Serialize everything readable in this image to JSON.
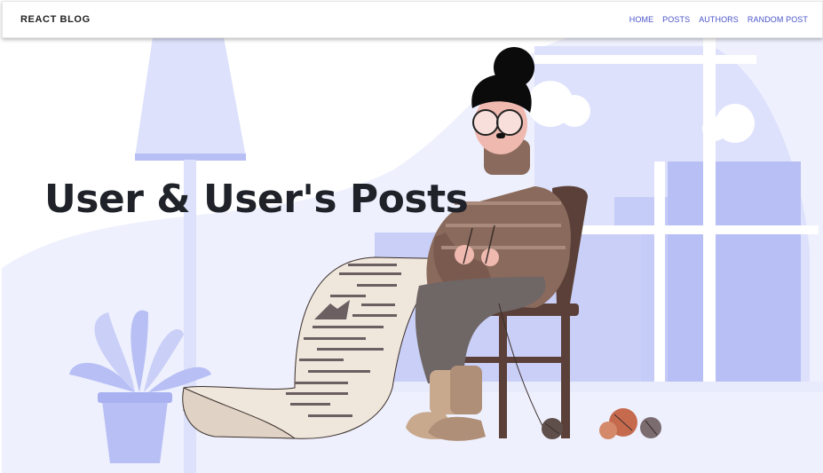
{
  "navbar": {
    "brand": "REACT BLOG",
    "links": [
      {
        "label": "HOME"
      },
      {
        "label": "POSTS"
      },
      {
        "label": "AUTHORS"
      },
      {
        "label": "RANDOM POST"
      }
    ]
  },
  "hero": {
    "title": "User & User's Posts"
  },
  "colors": {
    "accent": "#4a55c9",
    "illustration_light": "#dde1fb",
    "illustration_mid": "#b7bff5",
    "sweater": "#8a6a5c"
  }
}
